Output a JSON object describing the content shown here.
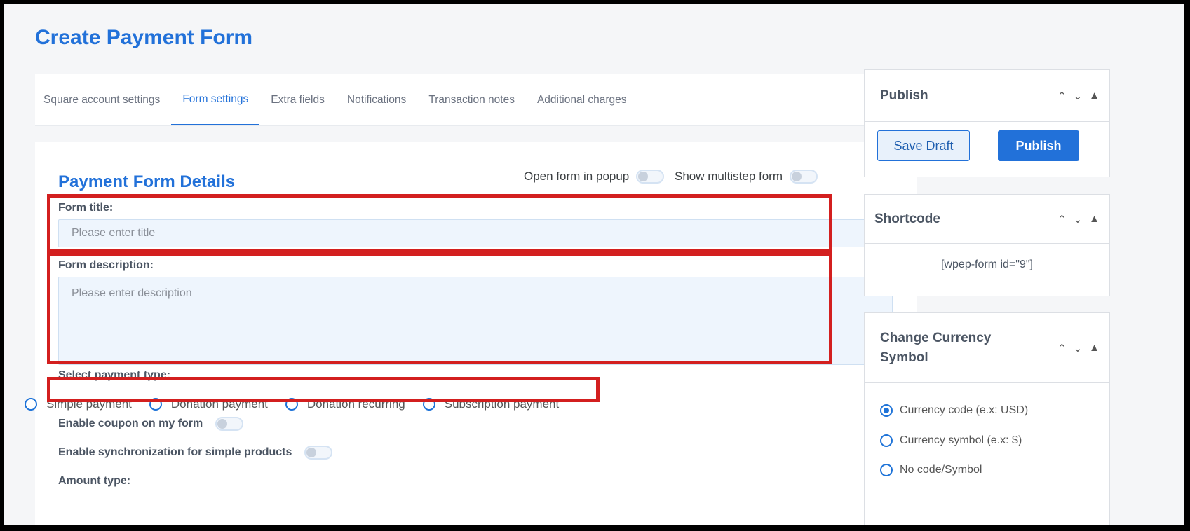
{
  "page": {
    "title": "Create Payment Form"
  },
  "tabs": [
    {
      "label": "Square account settings",
      "active": false
    },
    {
      "label": "Form settings",
      "active": true
    },
    {
      "label": "Extra fields",
      "active": false
    },
    {
      "label": "Notifications",
      "active": false
    },
    {
      "label": "Transaction notes",
      "active": false
    },
    {
      "label": "Additional charges",
      "active": false
    }
  ],
  "details": {
    "title": "Payment Form Details",
    "popup_toggle": {
      "label": "Open form in popup",
      "on": false
    },
    "multistep_toggle": {
      "label": "Show multistep form",
      "on": false
    },
    "form_title": {
      "label": "Form title:",
      "placeholder": "Please enter title",
      "value": ""
    },
    "form_description": {
      "label": "Form description:",
      "placeholder": "Please enter description",
      "value": ""
    },
    "payment_type": {
      "label": "Select payment type:",
      "options": [
        "Simple payment",
        "Donation payment",
        "Donation recurring",
        "Subscription payment"
      ],
      "selected": null
    },
    "coupon": {
      "label": "Enable coupon on my form",
      "on": false
    },
    "sync": {
      "label": "Enable synchronization for simple products",
      "on": false
    },
    "amount_type": {
      "label": "Amount type:"
    }
  },
  "sidebar": {
    "publish": {
      "title": "Publish",
      "save_draft": "Save Draft",
      "publish": "Publish"
    },
    "shortcode": {
      "title": "Shortcode",
      "code": "[wpep-form id=\"9\"]"
    },
    "currency": {
      "title": "Change Currency Symbol",
      "options": [
        "Currency code (e.x: USD)",
        "Currency symbol (e.x: $)",
        "No code/Symbol"
      ],
      "selected": 0
    }
  },
  "colors": {
    "accent": "#2271d9",
    "highlight": "#d31f1f",
    "input_bg": "#eef5fd"
  }
}
